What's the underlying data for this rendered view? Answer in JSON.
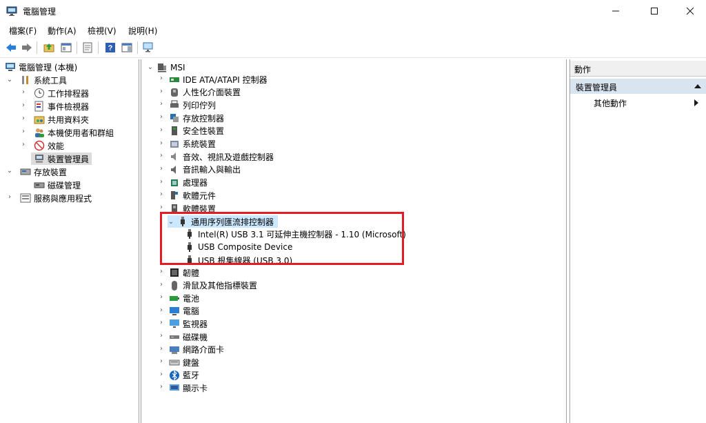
{
  "window": {
    "title": "電腦管理"
  },
  "menu": [
    "檔案(F)",
    "動作(A)",
    "檢視(V)",
    "說明(H)"
  ],
  "left_tree": {
    "root": "電腦管理 (本機)",
    "system_tools": "系統工具",
    "task_scheduler": "工作排程器",
    "event_viewer": "事件檢視器",
    "shared_folders": "共用資料夾",
    "local_users": "本機使用者和群組",
    "performance": "效能",
    "device_manager": "裝置管理員",
    "storage": "存放裝置",
    "disk_management": "磁碟管理",
    "services": "服務與應用程式"
  },
  "device_tree": {
    "root": "MSI",
    "categories": [
      "IDE ATA/ATAPI 控制器",
      "人性化介面裝置",
      "列印佇列",
      "存放控制器",
      "安全性裝置",
      "系統裝置",
      "音效、視訊及遊戲控制器",
      "音訊輸入與輸出",
      "處理器",
      "軟體元件",
      "軟體裝置"
    ],
    "usb_category": "通用序列匯流排控制器",
    "usb_children": [
      "Intel(R) USB 3.1 可延伸主機控制器 - 1.10 (Microsoft)",
      "USB Composite Device",
      "USB 根集線器 (USB 3.0)"
    ],
    "categories_after": [
      "韌體",
      "滑鼠及其他指標裝置",
      "電池",
      "電腦",
      "監視器",
      "磁碟機",
      "網路介面卡",
      "鍵盤",
      "藍牙",
      "顯示卡"
    ]
  },
  "actions": {
    "header": "動作",
    "section": "裝置管理員",
    "more": "其他動作"
  },
  "colors": {
    "highlight_box": "#e21b24",
    "selection": "#cce8ff"
  }
}
